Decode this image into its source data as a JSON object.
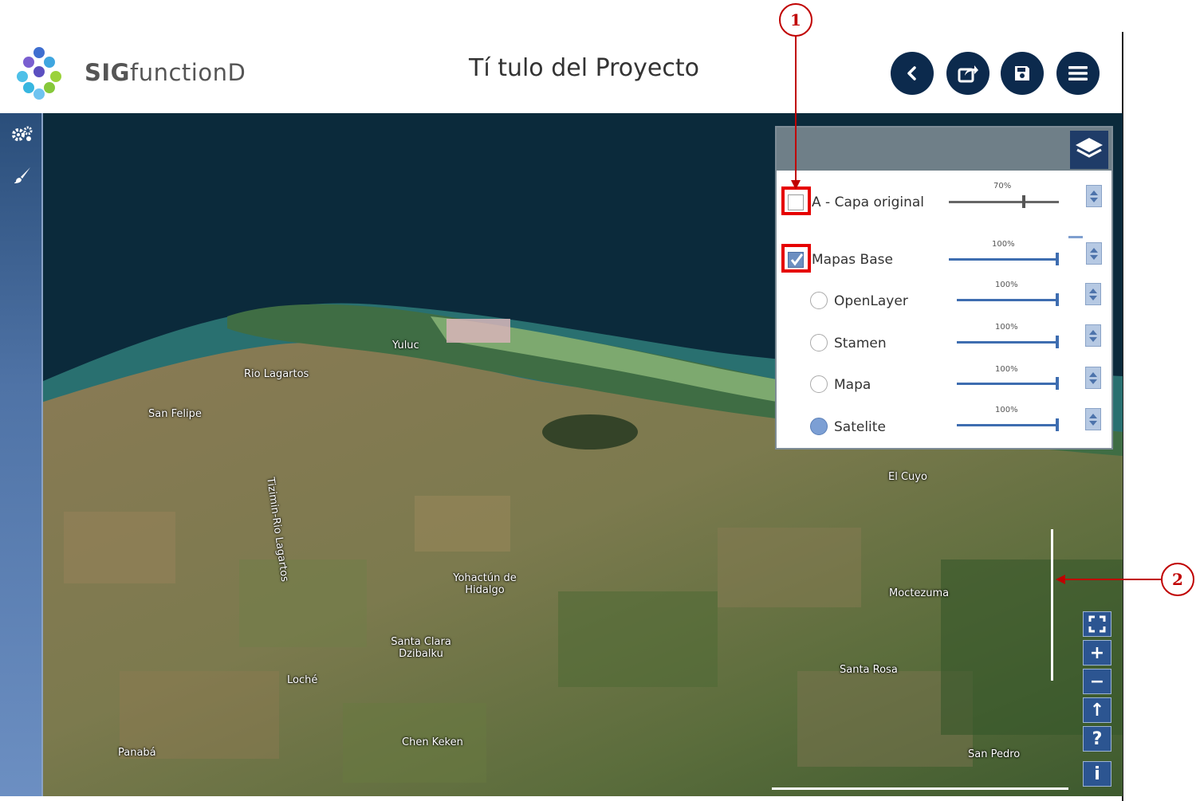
{
  "header": {
    "brand_bold": "SIG",
    "brand_rest": "functionD",
    "project_title": "Tí tulo del Proyecto",
    "buttons": [
      {
        "name": "back",
        "icon": "chevron-left-icon"
      },
      {
        "name": "share",
        "icon": "share-icon"
      },
      {
        "name": "save",
        "icon": "save-icon"
      },
      {
        "name": "menu",
        "icon": "hamburger-menu-icon"
      }
    ],
    "button_color": "#0c2a4d"
  },
  "left_toolbar": {
    "tools": [
      {
        "name": "settings",
        "icon": "gears-icon"
      },
      {
        "name": "style",
        "icon": "brush-icon"
      }
    ]
  },
  "layer_panel": {
    "layers_icon": "layers-icon",
    "layers": [
      {
        "label": "A - Capa original",
        "opacity": "70%",
        "checked": false
      },
      {
        "label": "Mapas Base",
        "opacity": "100%",
        "checked": true
      }
    ],
    "base_maps": [
      {
        "label": "OpenLayer",
        "opacity": "100%",
        "selected": false
      },
      {
        "label": "Stamen",
        "opacity": "100%",
        "selected": false
      },
      {
        "label": "Mapa",
        "opacity": "100%",
        "selected": false
      },
      {
        "label": "Satelite",
        "opacity": "100%",
        "selected": true
      }
    ]
  },
  "map": {
    "places": [
      "Yuluc",
      "Rio Lagartos",
      "San Felipe",
      "Tizimin-Rio Lagartos",
      "El Cuyo",
      "Moctezuma",
      "Yohactún de Hidalgo",
      "Santa Clara Dzibalku",
      "Loché",
      "Santa Rosa",
      "Chen Keken",
      "Panabá",
      "San Pedro"
    ]
  },
  "map_controls": [
    {
      "name": "fullscreen",
      "icon": "fullscreen-icon"
    },
    {
      "name": "zoom-in",
      "icon": "plus-icon",
      "glyph": "+"
    },
    {
      "name": "zoom-out",
      "icon": "minus-icon",
      "glyph": "−"
    },
    {
      "name": "north-up",
      "icon": "arrow-up-icon",
      "glyph": "↑"
    },
    {
      "name": "help",
      "icon": "question-icon",
      "glyph": "?"
    },
    {
      "name": "info",
      "icon": "info-icon",
      "glyph": "i"
    }
  ],
  "annotations": {
    "callout_1": "1",
    "callout_2": "2",
    "color": "#c00000"
  }
}
